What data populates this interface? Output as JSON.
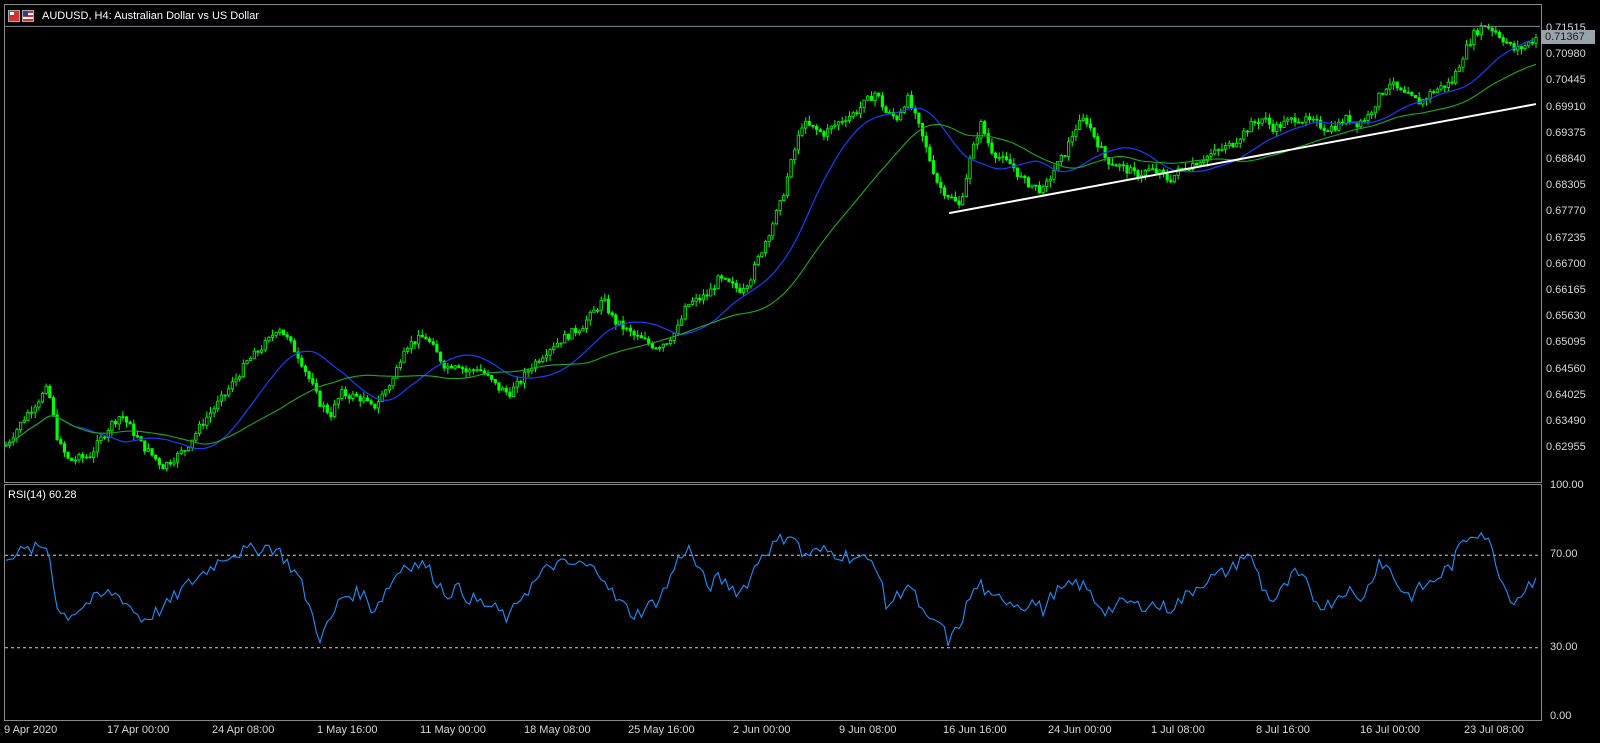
{
  "title": {
    "symbol_line": "AUDUSD, H4:  Australian Dollar vs US Dollar"
  },
  "price_axis": {
    "labels": [
      "0.71515",
      "0.70980",
      "0.70445",
      "0.69910",
      "0.69375",
      "0.68840",
      "0.68305",
      "0.67770",
      "0.67235",
      "0.66700",
      "0.66165",
      "0.65630",
      "0.65095",
      "0.64560",
      "0.64025",
      "0.63490",
      "0.62955"
    ],
    "current_price": "0.71367"
  },
  "rsi": {
    "label": "RSI(14) 60.28",
    "axis_labels": [
      "100.00",
      "70.00",
      "30.00",
      "0.00"
    ],
    "levels": [
      70,
      30
    ]
  },
  "time_axis": {
    "labels": [
      "9 Apr 2020",
      "17 Apr 00:00",
      "24 Apr 08:00",
      "1 May 16:00",
      "11 May 00:00",
      "18 May 08:00",
      "25 May 16:00",
      "2 Jun 00:00",
      "9 Jun 08:00",
      "16 Jun 16:00",
      "24 Jun 00:00",
      "1 Jul 08:00",
      "8 Jul 16:00",
      "16 Jul 00:00",
      "23 Jul 08:00"
    ]
  },
  "colors": {
    "background": "#000000",
    "candle": "#00ff00",
    "ma_fast": "#1e3cff",
    "ma_slow": "#1faa1f",
    "trendline": "#ffffff",
    "rsi_line": "#1e90ff",
    "grid_frame": "#8a8a8a",
    "price_tag_bg": "#98a3ab"
  },
  "chart_data": {
    "type": "candlestick",
    "symbol": "AUDUSD",
    "timeframe": "H4",
    "ylim": [
      0.6265,
      0.7172
    ],
    "close_path": [
      [
        0,
        0.633
      ],
      [
        2,
        0.639
      ],
      [
        4,
        0.644
      ],
      [
        5,
        0.6335
      ],
      [
        6,
        0.63
      ],
      [
        8,
        0.631
      ],
      [
        10,
        0.637
      ],
      [
        11,
        0.639
      ],
      [
        13,
        0.633
      ],
      [
        15,
        0.629
      ],
      [
        17,
        0.632
      ],
      [
        19,
        0.638
      ],
      [
        21,
        0.643
      ],
      [
        23,
        0.649
      ],
      [
        25,
        0.653
      ],
      [
        26,
        0.656
      ],
      [
        28,
        0.65
      ],
      [
        30,
        0.641
      ],
      [
        31,
        0.639
      ],
      [
        32,
        0.643
      ],
      [
        34,
        0.642
      ],
      [
        35,
        0.64
      ],
      [
        37,
        0.646
      ],
      [
        38,
        0.652
      ],
      [
        40,
        0.654
      ],
      [
        42,
        0.648
      ],
      [
        43,
        0.649
      ],
      [
        44,
        0.647
      ],
      [
        45,
        0.648
      ],
      [
        47,
        0.644
      ],
      [
        48,
        0.643
      ],
      [
        49,
        0.645
      ],
      [
        50,
        0.648
      ],
      [
        52,
        0.652
      ],
      [
        55,
        0.656
      ],
      [
        57,
        0.661
      ],
      [
        58,
        0.657
      ],
      [
        60,
        0.654
      ],
      [
        62,
        0.652
      ],
      [
        63,
        0.653
      ],
      [
        64,
        0.655
      ],
      [
        65,
        0.66
      ],
      [
        67,
        0.662
      ],
      [
        68,
        0.665
      ],
      [
        70,
        0.663
      ],
      [
        71,
        0.665
      ],
      [
        72,
        0.67
      ],
      [
        74,
        0.68
      ],
      [
        75,
        0.688
      ],
      [
        76,
        0.695
      ],
      [
        78,
        0.693
      ],
      [
        80,
        0.696
      ],
      [
        81,
        0.697
      ],
      [
        82,
        0.699
      ],
      [
        83,
        0.701
      ],
      [
        84,
        0.697
      ],
      [
        85,
        0.696
      ],
      [
        86,
        0.7
      ],
      [
        87,
        0.695
      ],
      [
        88,
        0.689
      ],
      [
        89,
        0.683
      ],
      [
        90,
        0.681
      ],
      [
        91,
        0.679
      ],
      [
        92,
        0.688
      ],
      [
        93,
        0.695
      ],
      [
        94,
        0.69
      ],
      [
        95,
        0.688
      ],
      [
        96,
        0.687
      ],
      [
        97,
        0.684
      ],
      [
        98,
        0.683
      ],
      [
        99,
        0.682
      ],
      [
        100,
        0.686
      ],
      [
        101,
        0.689
      ],
      [
        102,
        0.694
      ],
      [
        103,
        0.696
      ],
      [
        104,
        0.692
      ],
      [
        105,
        0.688
      ],
      [
        106,
        0.687
      ],
      [
        107,
        0.686
      ],
      [
        108,
        0.685
      ],
      [
        109,
        0.686
      ],
      [
        110,
        0.6855
      ],
      [
        111,
        0.684
      ],
      [
        112,
        0.686
      ],
      [
        113,
        0.687
      ],
      [
        114,
        0.688
      ],
      [
        115,
        0.689
      ],
      [
        116,
        0.69
      ],
      [
        117,
        0.691
      ],
      [
        118,
        0.693
      ],
      [
        119,
        0.695
      ],
      [
        120,
        0.696
      ],
      [
        121,
        0.694
      ],
      [
        122,
        0.695
      ],
      [
        123,
        0.696
      ],
      [
        124,
        0.6955
      ],
      [
        125,
        0.695
      ],
      [
        126,
        0.694
      ],
      [
        127,
        0.6945
      ],
      [
        128,
        0.696
      ],
      [
        129,
        0.695
      ],
      [
        130,
        0.6965
      ],
      [
        131,
        0.7
      ],
      [
        132,
        0.703
      ],
      [
        133,
        0.701
      ],
      [
        134,
        0.7
      ],
      [
        135,
        0.699
      ],
      [
        136,
        0.701
      ],
      [
        137,
        0.702
      ],
      [
        138,
        0.703
      ],
      [
        139,
        0.708
      ],
      [
        140,
        0.712
      ],
      [
        141,
        0.714
      ],
      [
        142,
        0.713
      ],
      [
        143,
        0.711
      ],
      [
        144,
        0.709
      ],
      [
        145,
        0.71
      ],
      [
        146,
        0.7115
      ]
    ],
    "trendline": {
      "from": [
        90,
        0.6777
      ],
      "to": [
        146,
        0.6987
      ]
    },
    "rsi_path": [
      [
        0,
        70
      ],
      [
        2,
        72
      ],
      [
        4,
        74
      ],
      [
        5,
        45
      ],
      [
        6,
        44
      ],
      [
        8,
        50
      ],
      [
        10,
        54
      ],
      [
        11,
        52
      ],
      [
        13,
        42
      ],
      [
        15,
        47
      ],
      [
        17,
        56
      ],
      [
        19,
        63
      ],
      [
        21,
        70
      ],
      [
        23,
        72
      ],
      [
        25,
        74
      ],
      [
        26,
        72
      ],
      [
        28,
        60
      ],
      [
        30,
        34
      ],
      [
        31,
        42
      ],
      [
        32,
        52
      ],
      [
        34,
        54
      ],
      [
        35,
        46
      ],
      [
        37,
        60
      ],
      [
        38,
        66
      ],
      [
        40,
        66
      ],
      [
        42,
        53
      ],
      [
        43,
        56
      ],
      [
        44,
        52
      ],
      [
        45,
        50
      ],
      [
        47,
        46
      ],
      [
        48,
        42
      ],
      [
        49,
        52
      ],
      [
        50,
        56
      ],
      [
        52,
        66
      ],
      [
        55,
        66
      ],
      [
        57,
        62
      ],
      [
        58,
        52
      ],
      [
        60,
        44
      ],
      [
        62,
        50
      ],
      [
        63,
        56
      ],
      [
        64,
        67
      ],
      [
        65,
        74
      ],
      [
        67,
        56
      ],
      [
        68,
        60
      ],
      [
        70,
        54
      ],
      [
        71,
        60
      ],
      [
        72,
        70
      ],
      [
        74,
        77
      ],
      [
        75,
        80
      ],
      [
        76,
        70
      ],
      [
        78,
        72
      ],
      [
        80,
        70
      ],
      [
        81,
        69
      ],
      [
        82,
        68
      ],
      [
        83,
        67
      ],
      [
        84,
        48
      ],
      [
        85,
        52
      ],
      [
        86,
        58
      ],
      [
        87,
        50
      ],
      [
        88,
        40
      ],
      [
        89,
        42
      ],
      [
        90,
        32
      ],
      [
        91,
        40
      ],
      [
        92,
        52
      ],
      [
        93,
        58
      ],
      [
        94,
        50
      ],
      [
        95,
        52
      ],
      [
        96,
        50
      ],
      [
        97,
        48
      ],
      [
        98,
        50
      ],
      [
        99,
        46
      ],
      [
        100,
        54
      ],
      [
        101,
        55
      ],
      [
        102,
        58
      ],
      [
        103,
        56
      ],
      [
        104,
        50
      ],
      [
        105,
        46
      ],
      [
        106,
        48
      ],
      [
        107,
        50
      ],
      [
        108,
        48
      ],
      [
        109,
        49
      ],
      [
        110,
        48
      ],
      [
        111,
        47
      ],
      [
        112,
        50
      ],
      [
        113,
        54
      ],
      [
        114,
        58
      ],
      [
        115,
        60
      ],
      [
        116,
        62
      ],
      [
        117,
        64
      ],
      [
        118,
        70
      ],
      [
        119,
        68
      ],
      [
        120,
        55
      ],
      [
        121,
        50
      ],
      [
        122,
        56
      ],
      [
        123,
        62
      ],
      [
        124,
        58
      ],
      [
        125,
        50
      ],
      [
        126,
        48
      ],
      [
        127,
        52
      ],
      [
        128,
        56
      ],
      [
        129,
        50
      ],
      [
        130,
        56
      ],
      [
        131,
        68
      ],
      [
        132,
        64
      ],
      [
        133,
        56
      ],
      [
        134,
        52
      ],
      [
        135,
        56
      ],
      [
        136,
        58
      ],
      [
        137,
        62
      ],
      [
        138,
        66
      ],
      [
        139,
        76
      ],
      [
        140,
        80
      ],
      [
        141,
        80
      ],
      [
        142,
        70
      ],
      [
        143,
        56
      ],
      [
        144,
        50
      ],
      [
        145,
        56
      ],
      [
        146,
        60.28
      ]
    ]
  }
}
